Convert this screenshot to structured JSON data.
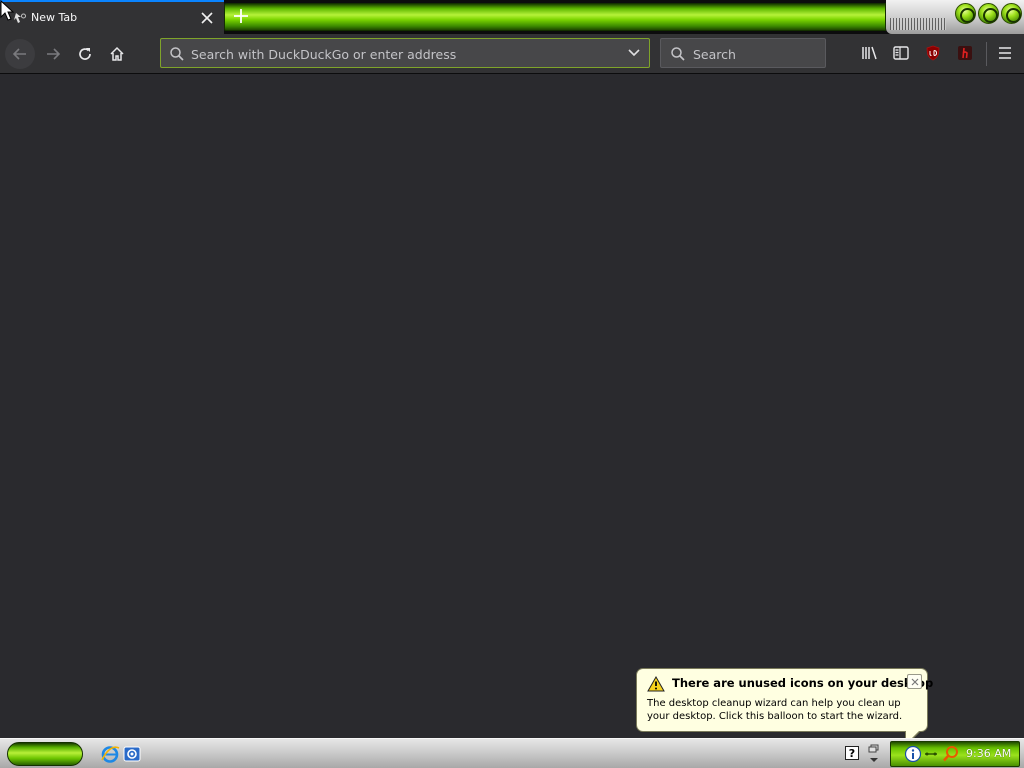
{
  "browser": {
    "tabs": [
      {
        "title": "New Tab",
        "active": true
      }
    ],
    "urlbar": {
      "placeholder": "Search with DuckDuckGo or enter address",
      "value": ""
    },
    "searchbar": {
      "placeholder": "Search",
      "value": ""
    },
    "toolbar_icons": [
      "back-icon",
      "forward-icon",
      "reload-icon",
      "home-icon",
      "library-icon",
      "sidebar-icon",
      "ublock-icon",
      "extension-icon",
      "menu-icon"
    ]
  },
  "balloon": {
    "title": "There are unused icons on your desktop",
    "text": "The desktop cleanup wizard can help you clean up your desktop. Click this balloon to start the wizard."
  },
  "taskbar": {
    "clock": "9:36 AM"
  },
  "colors": {
    "accent_green": "#7bd400",
    "tab_highlight": "#0a84ff",
    "content_bg": "#2a2a2e",
    "balloon_bg": "#ffffe1"
  }
}
